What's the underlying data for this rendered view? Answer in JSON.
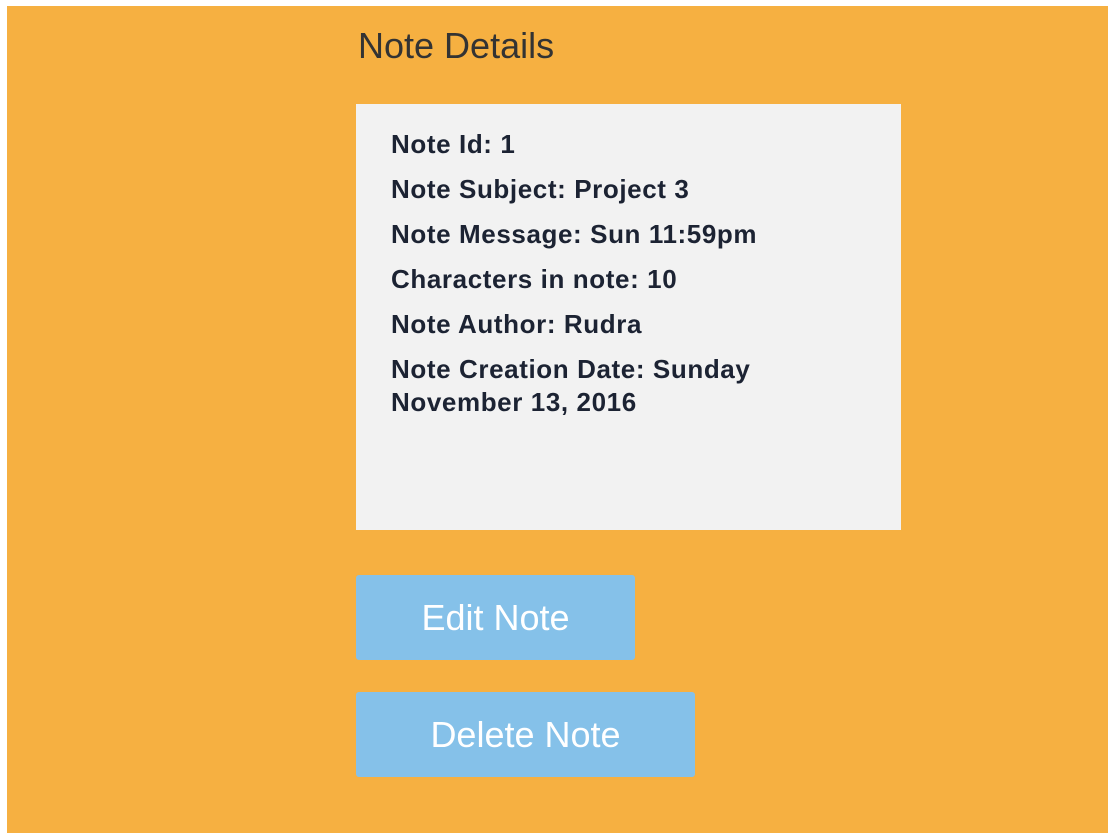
{
  "page": {
    "title": "Note Details"
  },
  "note": {
    "id_line": "Note Id: 1",
    "subject_line": "Note Subject: Project 3",
    "message_line": "Note Message: Sun 11:59pm",
    "characters_line": "Characters in note: 10",
    "author_line": "Note Author: Rudra",
    "creation_date_line": "Note Creation Date: Sunday November 13, 2016"
  },
  "actions": {
    "edit_label": "Edit Note",
    "delete_label": "Delete Note"
  },
  "colors": {
    "background": "#f6b041",
    "card": "#f2f2f2",
    "button": "#85c1e9",
    "button_text": "#ffffff",
    "detail_text": "#1c2333",
    "title_text": "#333333"
  }
}
